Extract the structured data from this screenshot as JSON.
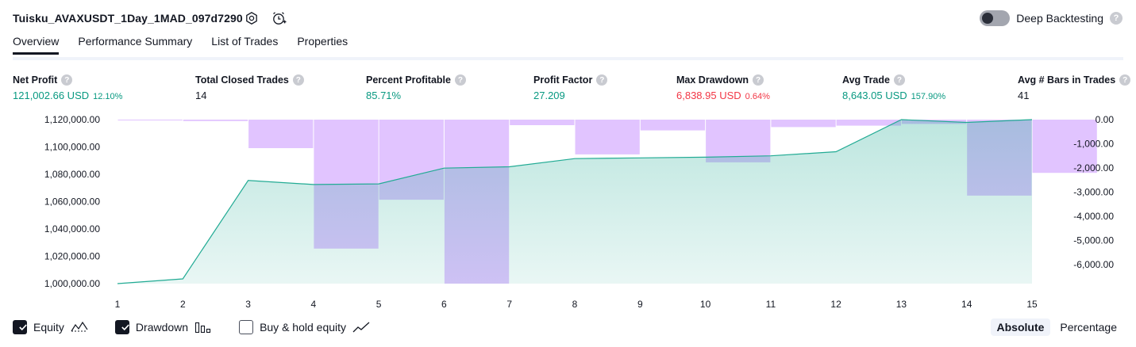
{
  "header": {
    "strategy_title": "Tuisku_AVAXUSDT_1Day_1MAD_097d7290",
    "deep_backtesting_label": "Deep Backtesting",
    "help_glyph": "?"
  },
  "tabs": [
    {
      "label": "Overview",
      "active": true
    },
    {
      "label": "Performance Summary"
    },
    {
      "label": "List of Trades"
    },
    {
      "label": "Properties"
    }
  ],
  "metrics": [
    {
      "label": "Net Profit",
      "value": "121,002.66 USD",
      "pct": "12.10%",
      "color": "#089981"
    },
    {
      "label": "Total Closed Trades",
      "value": "14",
      "pct": "",
      "color": "#131722"
    },
    {
      "label": "Percent Profitable",
      "value": "85.71%",
      "pct": "",
      "color": "#089981"
    },
    {
      "label": "Profit Factor",
      "value": "27.209",
      "pct": "",
      "color": "#089981"
    },
    {
      "label": "Max Drawdown",
      "value": "6,838.95 USD",
      "pct": "0.64%",
      "color": "#f23645"
    },
    {
      "label": "Avg Trade",
      "value": "8,643.05 USD",
      "pct": "157.90%",
      "color": "#089981"
    },
    {
      "label": "Avg # Bars in Trades",
      "value": "41",
      "pct": "",
      "color": "#131722"
    }
  ],
  "legend": {
    "equity_label": "Equity",
    "drawdown_label": "Drawdown",
    "buyhold_label": "Buy & hold equity",
    "absolute_label": "Absolute",
    "percentage_label": "Percentage"
  },
  "colors": {
    "equity_line": "#22ab94",
    "drawdown_bar": "#cfa0ff",
    "accent_green": "#089981",
    "accent_red": "#f23645"
  },
  "chart_data": {
    "type": "bar",
    "x": [
      1,
      2,
      3,
      4,
      5,
      6,
      7,
      8,
      9,
      10,
      11,
      12,
      13,
      14,
      15
    ],
    "left_ticks": [
      "1,120,000.00",
      "1,100,000.00",
      "1,080,000.00",
      "1,060,000.00",
      "1,040,000.00",
      "1,020,000.00",
      "1,000,000.00"
    ],
    "right_ticks": [
      "0.00",
      "-1,000.00",
      "-2,000.00",
      "-3,000.00",
      "-4,000.00",
      "-5,000.00",
      "-6,000.00"
    ],
    "left_ylim": [
      1000000,
      1120000
    ],
    "right_ylim": [
      -6838.95,
      0
    ],
    "series": [
      {
        "name": "Equity",
        "kind": "area",
        "values": [
          1000000,
          1003500,
          1075500,
          1072500,
          1073000,
          1084500,
          1085500,
          1091500,
          1092000,
          1092500,
          1093500,
          1096500,
          1120000,
          1118000,
          1120000
        ]
      },
      {
        "name": "Drawdown",
        "kind": "bar",
        "values": [
          -20,
          -60,
          -1190,
          -5380,
          -3340,
          -6839,
          -230,
          -1450,
          -450,
          -1780,
          -310,
          -250,
          -180,
          -3170,
          -2220
        ]
      }
    ]
  }
}
